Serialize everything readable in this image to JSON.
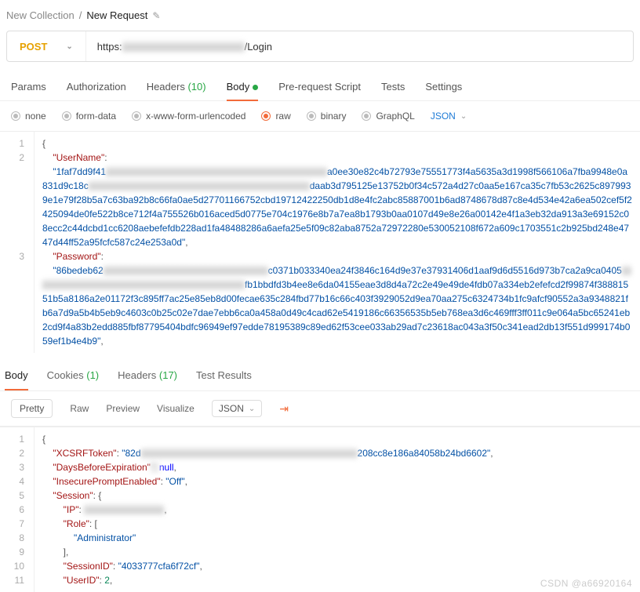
{
  "breadcrumb": {
    "collection": "New Collection",
    "request": "New Request"
  },
  "method": "POST",
  "url_prefix": "https:",
  "url_suffix": "/Login",
  "tabs": {
    "params": "Params",
    "auth": "Authorization",
    "headers": "Headers",
    "headers_count": "(10)",
    "body": "Body",
    "prereq": "Pre-request Script",
    "tests": "Tests",
    "settings": "Settings"
  },
  "body_types": {
    "none": "none",
    "formdata": "form-data",
    "xwww": "x-www-form-urlencoded",
    "raw": "raw",
    "binary": "binary",
    "graphql": "GraphQL",
    "json": "JSON"
  },
  "req_editor": {
    "line1": "{",
    "line2_key": "\"UserName\"",
    "line2_val_a": "\"1faf7dd9f41",
    "line2_val_redacted": "xxxxxxxxxxxxxxxxxxxxxxxxxxxxxxxxxxxxxxxxxxxxxxx",
    "line2_val_b": "a0ee30e82c4b72793e75551773f4a5635a3d1998f566106a7fba9948e0a831d9c18c",
    "line2_val_redacted2": "xxxxxxxxxxxxxxxxxxxxxxxxxxxxxxxxxxxxxxxxxxxxxxx",
    "line2_val_c": "daab3d795125e13752b0f34c572a4d27c0aa5e167ca35c7fb53c2625c8979939e1e79f28b5a7c63ba92b8c66fa0ae5d27701166752cbd19712422250db1d8e4fc2abc85887001b6ad8748678d87c8e4d534e42a6ea502cef5f2425094de0fe522b8ce712f4a755526b016aced5d0775e704c1976e8b7a7ea8b1793b0aa0107d49e8e26a00142e4f1a3eb32da913a3e69152c08ecc2c44dcbd1cc6208aebefefdb228ad1fa48488286a6aefa25e5f09c82aba8752a72972280e530052108f672a609c1703551c2b925bd248e4747d44ff52a95fcfc587c24e253a0d\"",
    "line3_key": "\"Password\"",
    "line3_val_a": "\"86bedeb62",
    "line3_val_redacted": "xxxxxxxxxxxxxxxxxxxxxxxxxxxxxxxxxxx",
    "line3_val_b": "c0371b033340ea24f3846c164d9e37e37931406d1aaf9d6d5516d973b7ca2a9ca0405",
    "line3_val_redacted2": "xxxxxxxxxxxxxxxxxxxxxxxxxxxxxxxxxxxxxxxxxxxxx",
    "line3_val_c": "fb1bbdfd3b4ee8e6da04155eae3d8d4a72c2e49e49de4fdb07a334eb2efefcd2f99874f38881551b5a8186a2e01172f3c895ff7ac25e85eb8d00fecae635c284fbd77b16c66c403f3929052d9ea70aa275c6324734b1fc9afcf90552a3a9348821fb6a7d9a5b4b5eb9c4603c0b25c02e7dae7ebb6ca0a458a0d49c4cad62e5419186c66356535b5eb768ea3d6c469fff3ff011c9e064a5bc65241eb2cd9f4a83b2edd885fbf87795404bdfc96949ef97edde78195389c89ed62f53cee033ab29ad7c23618ac043a3f50c341ead2db13f551d999174b059ef1b4e4b9\""
  },
  "resp_tabs": {
    "body": "Body",
    "cookies": "Cookies",
    "cookies_count": "(1)",
    "headers": "Headers",
    "headers_count": "(17)",
    "tests": "Test Results"
  },
  "resp_toolbar": {
    "pretty": "Pretty",
    "raw": "Raw",
    "preview": "Preview",
    "visualize": "Visualize",
    "json": "JSON"
  },
  "resp": {
    "l1": "{",
    "l2_k": "\"XCSRFToken\"",
    "l2_v_a": "\"82d",
    "l2_v_red": "xxxxxxxxxxxxxxxxxxxxxxxxxxxxxxxxxxxxxxxxxxxxxx",
    "l2_v_b": "208cc8e186a84058b24bd6602\"",
    "l3_k": "\"DaysBeforeExpiration\"",
    "l3_v": "null",
    "l4_k": "\"InsecurePromptEnabled\"",
    "l4_v": "\"Off\"",
    "l5_k": "\"Session\"",
    "l5_v": "{",
    "l6_k": "\"IP\"",
    "l6_v_red": "xxxxxxxxxxxxxxxxx",
    "l7_k": "\"Role\"",
    "l7_v": "[",
    "l8_v": "\"Administrator\"",
    "l9": "],",
    "l10_k": "\"SessionID\"",
    "l10_v": "\"4033777cfa6f72cf\"",
    "l11_k": "\"UserID\"",
    "l11_v": "2"
  },
  "watermark": "CSDN @a66920164"
}
